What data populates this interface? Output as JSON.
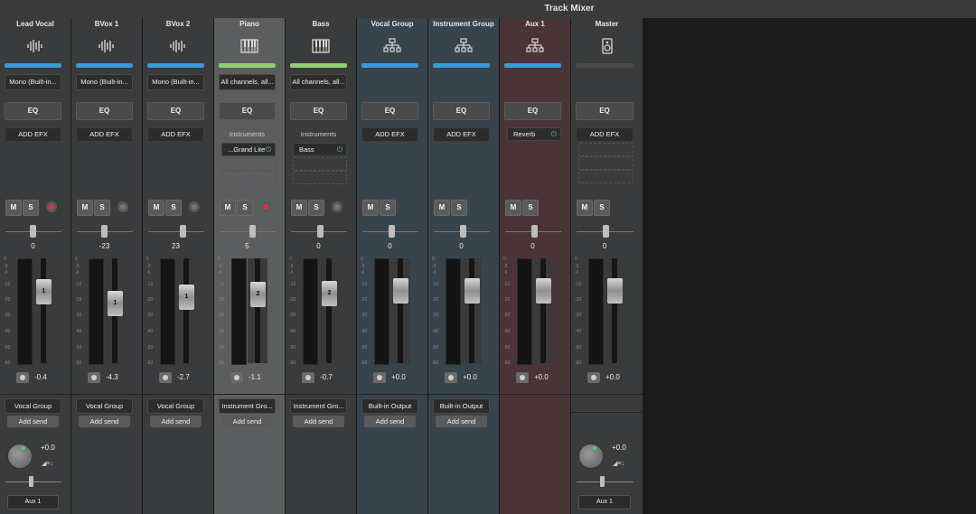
{
  "window": {
    "title": "Track Mixer"
  },
  "labels": {
    "eq": "EQ",
    "add_efx": "ADD EFX",
    "mute": "M",
    "solo": "S",
    "add_send": "Add send"
  },
  "colors": {
    "blue": "#3a9ad9",
    "green": "#8fcf6e",
    "red": "#e0314b",
    "gray": "#4a4a4a"
  },
  "tracks": [
    {
      "name": "Lead Vocal",
      "icon": "waveform-icon",
      "input": "Mono (Built-in...",
      "pan": "0",
      "fader_label": "1",
      "fader_level": 0.74,
      "gain": "-0.4",
      "output": "Vocal Group",
      "record_armed": true,
      "send": {
        "value": "+0.0",
        "target": "Aux 1"
      }
    },
    {
      "name": "BVox 1",
      "icon": "waveform-icon",
      "input": "Mono (Built-in...",
      "pan": "-23",
      "fader_label": "1",
      "fader_level": 0.59,
      "gain": "-4.3",
      "output": "Vocal Group",
      "record_armed": false
    },
    {
      "name": "BVox 2",
      "icon": "waveform-icon",
      "input": "Mono (Built-in...",
      "pan": "23",
      "fader_label": "1",
      "fader_level": 0.67,
      "gain": "-2.7",
      "output": "Vocal Group",
      "record_armed": false
    },
    {
      "name": "Piano",
      "icon": "piano-keys-icon",
      "input": "All channels, all...",
      "instruments_label": "Instruments",
      "plugin": "...Grand Lite",
      "pan": "5",
      "fader_label": "2",
      "fader_level": 0.71,
      "gain": "-1.1",
      "output": "Instrument Gro...",
      "record_armed": true
    },
    {
      "name": "Bass",
      "icon": "piano-keys-icon",
      "input": "All channels, all...",
      "instruments_label": "Instruments",
      "plugin": "Bass",
      "pan": "0",
      "fader_label": "2",
      "fader_level": 0.72,
      "gain": "-0.7",
      "output": "Instrument Gro...",
      "record_armed": false
    },
    {
      "name": "Vocal Group",
      "icon": "group-icon",
      "pan": "0",
      "fader_level": 0.75,
      "gain": "+0.0",
      "output": "Built-in Output"
    },
    {
      "name": "Instrument Group",
      "icon": "group-icon",
      "pan": "0",
      "fader_level": 0.75,
      "gain": "+0.0",
      "output": "Built-in Output"
    },
    {
      "name": "Aux 1",
      "icon": "group-icon",
      "plugin": "Reverb",
      "pan": "0",
      "fader_level": 0.75,
      "gain": "+0.0"
    },
    {
      "name": "Master",
      "icon": "speaker-icon",
      "pan": "0",
      "fader_level": 0.75,
      "gain": "+0.0",
      "send": {
        "value": "+0.0",
        "target": "Aux 1"
      }
    }
  ],
  "meter_scale": [
    "0",
    "-3",
    "-6",
    "-12",
    "-20",
    "-30",
    "-40",
    "-50",
    "-60"
  ]
}
